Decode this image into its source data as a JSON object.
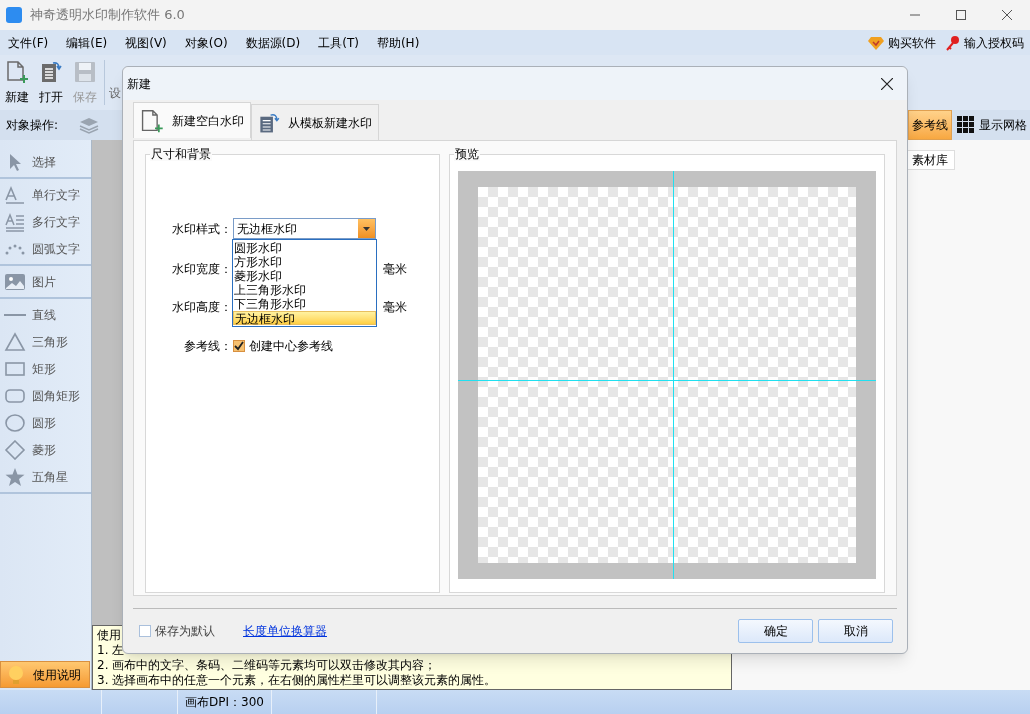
{
  "window": {
    "title": "神奇透明水印制作软件 6.0"
  },
  "menu": [
    "文件(F)",
    "编辑(E)",
    "视图(V)",
    "对象(O)",
    "数据源(D)",
    "工具(T)",
    "帮助(H)"
  ],
  "menu_right": [
    {
      "label": "购买软件",
      "kind": "diamond"
    },
    {
      "label": "输入授权码",
      "kind": "key"
    }
  ],
  "toolbar": [
    {
      "label": "新建",
      "kind": "new",
      "disabled": false
    },
    {
      "label": "打开",
      "kind": "open",
      "disabled": false
    },
    {
      "label": "保存",
      "kind": "save",
      "disabled": true
    },
    {
      "label": "设",
      "kind": "none"
    }
  ],
  "object_bar": {
    "label": "对象操作:",
    "toggles": [
      {
        "label": "参考线",
        "kind": "guide",
        "on": true
      },
      {
        "label": "显示网格",
        "kind": "grid",
        "on": false
      }
    ]
  },
  "sidebar": {
    "groups": [
      [
        {
          "label": "选择",
          "kind": "pointer"
        }
      ],
      [
        {
          "label": "单行文字",
          "kind": "text"
        },
        {
          "label": "多行文字",
          "kind": "multitext"
        },
        {
          "label": "圆弧文字",
          "kind": "arctext"
        }
      ],
      [
        {
          "label": "图片",
          "kind": "image"
        }
      ],
      [
        {
          "label": "直线",
          "kind": "line"
        },
        {
          "label": "三角形",
          "kind": "triangle"
        },
        {
          "label": "矩形",
          "kind": "rect"
        },
        {
          "label": "圆角矩形",
          "kind": "roundrect"
        },
        {
          "label": "圆形",
          "kind": "circle"
        },
        {
          "label": "菱形",
          "kind": "diamond"
        },
        {
          "label": "五角星",
          "kind": "star"
        }
      ]
    ],
    "help_button": "使用说明"
  },
  "right_panel": {
    "tabs": [
      {
        "label": "素材库",
        "selected": true
      }
    ]
  },
  "help_panel": {
    "title": "使用",
    "lines": [
      "1. 左",
      "2. 画布中的文字、条码、二维码等元素均可以双击修改其内容；",
      "3. 选择画布中的任意一个元素，在右侧的属性栏里可以调整该元素的属性。"
    ]
  },
  "status_bar": {
    "dpi": "画布DPI：300"
  },
  "dialog": {
    "title": "新建",
    "tabs": [
      {
        "label": "新建空白水印",
        "kind": "blank",
        "selected": true
      },
      {
        "label": "从模板新建水印",
        "kind": "template",
        "selected": false
      }
    ],
    "size_group": {
      "title": "尺寸和背景",
      "style_label": "水印样式：",
      "style_value": "无边框水印",
      "options": [
        {
          "label": "圆形水印",
          "selected": false
        },
        {
          "label": "方形水印",
          "selected": false
        },
        {
          "label": "菱形水印",
          "selected": false
        },
        {
          "label": "上三角形水印",
          "selected": false
        },
        {
          "label": "下三角形水印",
          "selected": false
        },
        {
          "label": "无边框水印",
          "selected": true
        }
      ],
      "width_label": "水印宽度：",
      "width_unit": "毫米",
      "height_label": "水印高度：",
      "height_unit": "毫米",
      "guide_label": "参考线：",
      "guide_checkbox": {
        "label": "创建中心参考线",
        "checked": true
      }
    },
    "preview": {
      "title": "预览"
    },
    "save_default": {
      "label": "保存为默认",
      "checked": false
    },
    "link": "长度单位换算器",
    "buttons": [
      "确定",
      "取消"
    ]
  }
}
